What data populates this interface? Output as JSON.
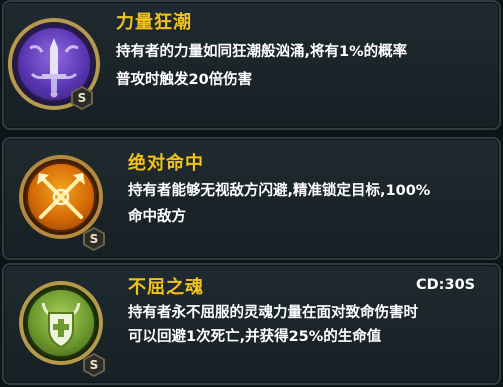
{
  "skills": [
    {
      "title": "力量狂潮",
      "desc_line1": "持有者的力量如同狂潮般汹涌,将有1%的概率",
      "desc_line2": "普攻时触发20倍伤害",
      "badge": "S",
      "icon": "sword-icon",
      "color": "#6b3fc4"
    },
    {
      "title": "绝对命中",
      "desc_line1": "持有者能够无视敌方闪避,精准锁定目标,100%",
      "desc_line2": "命中敌方",
      "badge": "S",
      "icon": "crossed-arrows-icon",
      "color": "#d27a0e"
    },
    {
      "title": "不屈之魂",
      "desc_line1": "持有者永不屈服的灵魂力量在面对致命伤害时",
      "desc_line2": "可以回避1次死亡,并获得25%的生命值",
      "badge": "S",
      "cooldown": "CD:30S",
      "icon": "horned-shield-cross-icon",
      "color": "#5f8a2c"
    }
  ]
}
